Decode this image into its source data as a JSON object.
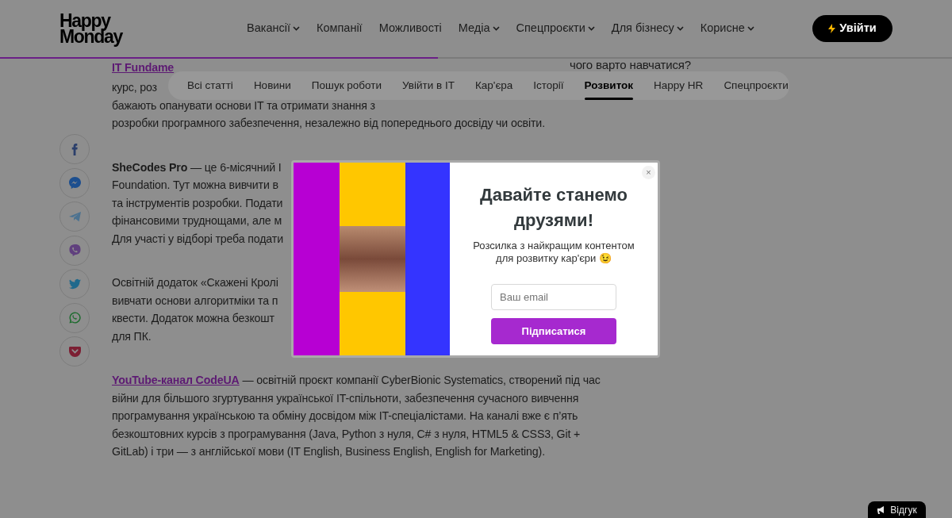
{
  "header": {
    "logo_lines": [
      "Happy",
      "Monday"
    ],
    "nav": [
      {
        "label": "Вакансії",
        "dropdown": true
      },
      {
        "label": "Компанії",
        "dropdown": false
      },
      {
        "label": "Можливості",
        "dropdown": false
      },
      {
        "label": "Медіа",
        "dropdown": true
      },
      {
        "label": "Спецпроєкти",
        "dropdown": true
      },
      {
        "label": "Для бізнесу",
        "dropdown": true
      },
      {
        "label": "Корисне",
        "dropdown": true
      }
    ],
    "login_button": {
      "label": "Увійти"
    }
  },
  "reading_progress": {
    "level": 0.46
  },
  "sticky_title": "чого варто навчатися?",
  "tabs": [
    {
      "label": "Всі статті",
      "selected": false
    },
    {
      "label": "Новини",
      "selected": false
    },
    {
      "label": "Пошук роботи",
      "selected": false
    },
    {
      "label": "Увійти в IT",
      "selected": false
    },
    {
      "label": "Кар'єра",
      "selected": false
    },
    {
      "label": "Історії",
      "selected": false
    },
    {
      "label": "Розвиток",
      "selected": true
    },
    {
      "label": "Happy HR",
      "selected": false
    },
    {
      "label": "Спецпроєкти",
      "selected": false
    }
  ],
  "share_buttons": [
    {
      "kind": "facebook"
    },
    {
      "kind": "messenger"
    },
    {
      "kind": "telegram"
    },
    {
      "kind": "viber"
    },
    {
      "kind": "twitter"
    },
    {
      "kind": "whatsapp"
    },
    {
      "kind": "pocket"
    }
  ],
  "article": [
    {
      "kind": "lines",
      "lines": [
        {
          "kind": "link",
          "text": "IT Fundame"
        },
        {
          "kind": "text",
          "text": "курс, роз"
        },
        {
          "kind": "text",
          "text": "бажають опанувати основи IT та отримати знання з"
        },
        {
          "kind": "text",
          "text": "розробки програмного забезпечення, незалежно від попереднього досвіду чи освіти."
        }
      ]
    },
    {
      "kind": "lines",
      "lines": [
        {
          "kind": "text",
          "text": "**SheCodes Pro** — це 6-місячний I"
        },
        {
          "kind": "text",
          "text": "Foundation. Тут можна вивчити в"
        },
        {
          "kind": "text",
          "text": "та інструментів розробки. Подати"
        },
        {
          "kind": "text",
          "text": "фінансовими труднощами, але м"
        },
        {
          "kind": "text",
          "text": "Для участі у відборі треба подати"
        }
      ]
    },
    {
      "kind": "lines",
      "lines": [
        {
          "kind": "text",
          "text": "Освітній додаток «Скажені Кролі"
        },
        {
          "kind": "text",
          "text": "вивчати основи алгоритміки та п"
        },
        {
          "kind": "text",
          "text": "квести. Додаток можна безкошт"
        },
        {
          "kind": "text",
          "text": "для ПК."
        }
      ]
    },
    {
      "kind": "paragraph",
      "link": "YouTube-канал CodeUA",
      "text": " — освітній проєкт компанії CyberBionic Systematics, створений під час війни для більшого згуртування української IT-спільноти, забезпечення сучасного вивчення програмування українською та обміну досвідом між IT-спеціалістами. На каналі вже є п’ять безкоштовних курсів з програмування (Java, Python з нуля, C# з нуля, HTML5 & CSS3, Git + GitLab) і три — з англійської мови (IT English, Business English, English for Marketing)."
    }
  ],
  "popup": {
    "title": "Давайте станемо друзями!",
    "subtitle": "Розсилка з найкращим контентом для розвитку кар'єри 😉",
    "email_placeholder": "Ваш email",
    "submit_label": "Підписатися",
    "close_label": "×"
  },
  "feedback_button": {
    "label": "Відгук"
  }
}
